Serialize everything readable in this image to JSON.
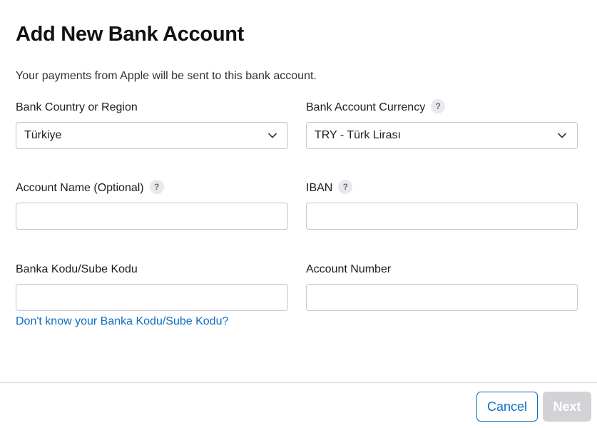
{
  "dialog": {
    "title": "Add New Bank Account",
    "subtitle": "Your payments from Apple will be sent to this bank account."
  },
  "fields": {
    "country": {
      "label": "Bank Country or Region",
      "value": "Türkiye"
    },
    "currency": {
      "label": "Bank Account Currency",
      "value": "TRY - Türk Lirası",
      "help": "?"
    },
    "account_name": {
      "label": "Account Name (Optional)",
      "value": "",
      "help": "?"
    },
    "iban": {
      "label": "IBAN",
      "value": "",
      "help": "?"
    },
    "bank_code": {
      "label": "Banka Kodu/Sube Kodu",
      "value": ""
    },
    "account_number": {
      "label": "Account Number",
      "value": ""
    }
  },
  "help_link": "Don't know your Banka Kodu/Sube Kodu?",
  "footer": {
    "cancel_label": "Cancel",
    "next_label": "Next"
  },
  "colors": {
    "link": "#0a6fc2",
    "disabled_button": "#d2d2d7",
    "border": "#c7c7cc"
  },
  "icons": {
    "help": "question-mark-circle-icon",
    "dropdown": "chevron-down-icon"
  }
}
